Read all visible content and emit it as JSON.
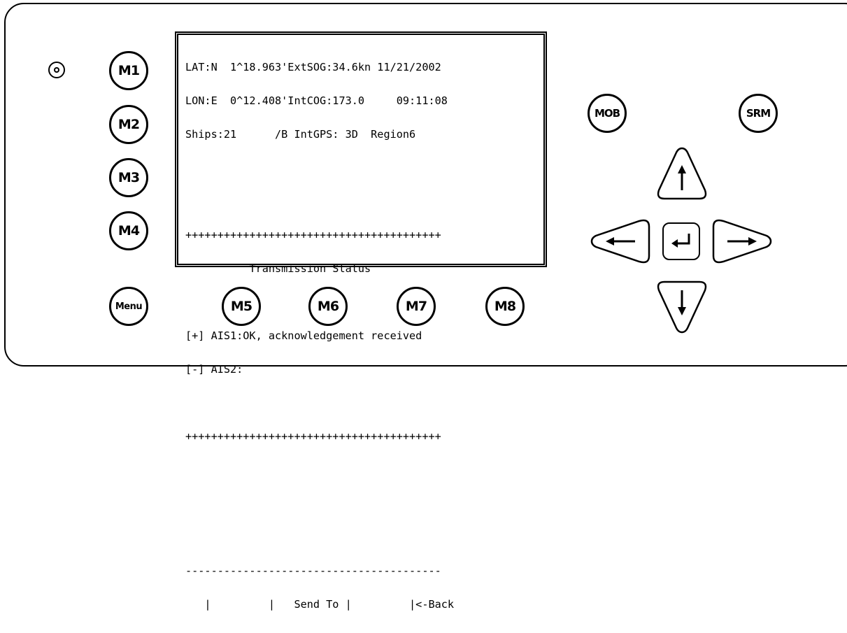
{
  "device": {
    "left_buttons": [
      {
        "id": "m1",
        "label": "M1"
      },
      {
        "id": "m2",
        "label": "M2"
      },
      {
        "id": "m3",
        "label": "M3"
      },
      {
        "id": "m4",
        "label": "M4"
      }
    ],
    "bottom_buttons": [
      {
        "id": "menu",
        "label": "Menu"
      },
      {
        "id": "m5",
        "label": "M5"
      },
      {
        "id": "m6",
        "label": "M6"
      },
      {
        "id": "m7",
        "label": "M7"
      },
      {
        "id": "m8",
        "label": "M8"
      }
    ],
    "right_buttons": [
      {
        "id": "mob",
        "label": "MOB"
      },
      {
        "id": "srm",
        "label": "SRM"
      }
    ],
    "arrow_keys": [
      "up-arrow-icon",
      "left-arrow-icon",
      "enter-icon",
      "right-arrow-icon",
      "down-arrow-icon"
    ]
  },
  "screen": {
    "lines": [
      "LAT:N  1^18.963'ExtSOG:34.6kn 11/21/2002",
      "LON:E  0^12.408'IntCOG:173.0     09:11:08",
      "Ships:21      /B IntGPS: 3D  Region6",
      "",
      "",
      "++++++++++++++++++++++++++++++++++++++++",
      "          Transmission Status",
      "",
      "[+] AIS1:OK, acknowledgement received",
      "[-] AIS2:",
      "",
      "++++++++++++++++++++++++++++++++++++++++",
      "",
      "",
      "",
      "----------------------------------------",
      "   |         |   Send To |         |<-Back"
    ]
  }
}
